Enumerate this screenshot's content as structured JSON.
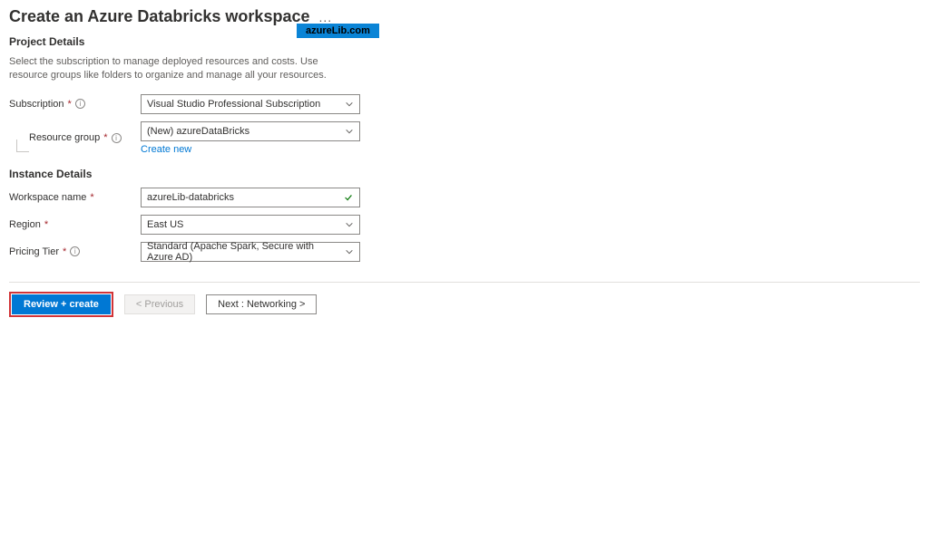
{
  "page": {
    "title": "Create an Azure Databricks workspace",
    "more_label": "..."
  },
  "watermark": {
    "text": "azureLib.com"
  },
  "project": {
    "heading": "Project Details",
    "description": "Select the subscription to manage deployed resources and costs. Use resource groups like folders to organize and manage all your resources.",
    "subscription_label": "Subscription",
    "subscription_value": "Visual Studio Professional Subscription",
    "resource_group_label": "Resource group",
    "resource_group_value": "(New) azureDataBricks",
    "create_new_link": "Create new"
  },
  "instance": {
    "heading": "Instance Details",
    "workspace_label": "Workspace name",
    "workspace_value": "azureLib-databricks",
    "region_label": "Region",
    "region_value": "East US",
    "tier_label": "Pricing Tier",
    "tier_value": "Standard (Apache Spark, Secure with Azure AD)"
  },
  "footer": {
    "review_create": "Review + create",
    "previous": "< Previous",
    "next": "Next : Networking >"
  }
}
